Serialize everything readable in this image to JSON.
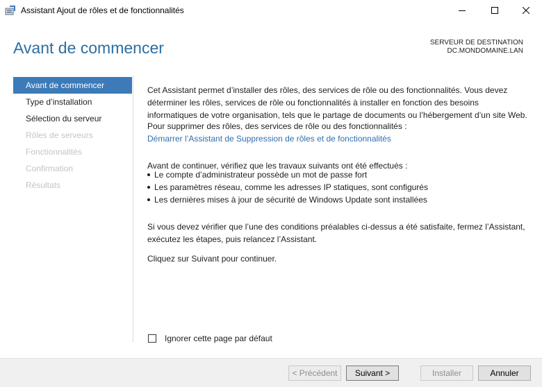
{
  "window": {
    "title": "Assistant Ajout de rôles et de fonctionnalités",
    "icon": "server-manager-icon"
  },
  "header": {
    "page_title": "Avant de commencer",
    "destination_label": "SERVEUR DE DESTINATION",
    "destination_server": "DC.MONDOMAINE.LAN"
  },
  "nav": {
    "items": [
      {
        "label": "Avant de commencer",
        "state": "active"
      },
      {
        "label": "Type d’installation",
        "state": "enabled"
      },
      {
        "label": "Sélection du serveur",
        "state": "enabled"
      },
      {
        "label": "Rôles de serveurs",
        "state": "disabled"
      },
      {
        "label": "Fonctionnalités",
        "state": "disabled"
      },
      {
        "label": "Confirmation",
        "state": "disabled"
      },
      {
        "label": "Résultats",
        "state": "disabled"
      }
    ]
  },
  "content": {
    "intro": "Cet Assistant permet d’installer des rôles, des services de rôle ou des fonctionnalités. Vous devez déterminer les rôles, services de rôle ou fonctionnalités à installer en fonction des besoins informatiques de votre organisation, tels que le partage de documents ou l’hébergement d’un site Web.",
    "remove_text": "Pour supprimer des rôles, des services de rôle ou des fonctionnalités :",
    "remove_link": "Démarrer l’Assistant de Suppression de rôles et de fonctionnalités",
    "before_text": "Avant de continuer, vérifiez que les travaux suivants ont été effectués :",
    "bullets": [
      "Le compte d’administrateur possède un mot de passe fort",
      "Les paramètres réseau, comme les adresses IP statiques, sont configurés",
      "Les dernières mises à jour de sécurité de Windows Update sont installées"
    ],
    "verify_text": "Si vous devez vérifier que l’une des conditions préalables ci-dessus a été satisfaite, fermez l’Assistant, exécutez les étapes, puis relancez l’Assistant.",
    "next_text": "Cliquez sur Suivant pour continuer."
  },
  "skip_checkbox": {
    "label": "Ignorer cette page par défaut",
    "checked": false
  },
  "buttons": {
    "previous": "< Précédent",
    "next": "Suivant >",
    "install": "Installer",
    "cancel": "Annuler"
  },
  "colors": {
    "title_blue": "#2d6ea0",
    "nav_active": "#3d7ab8",
    "link": "#2f6fb1",
    "disabled_text": "#c4c4c4"
  }
}
